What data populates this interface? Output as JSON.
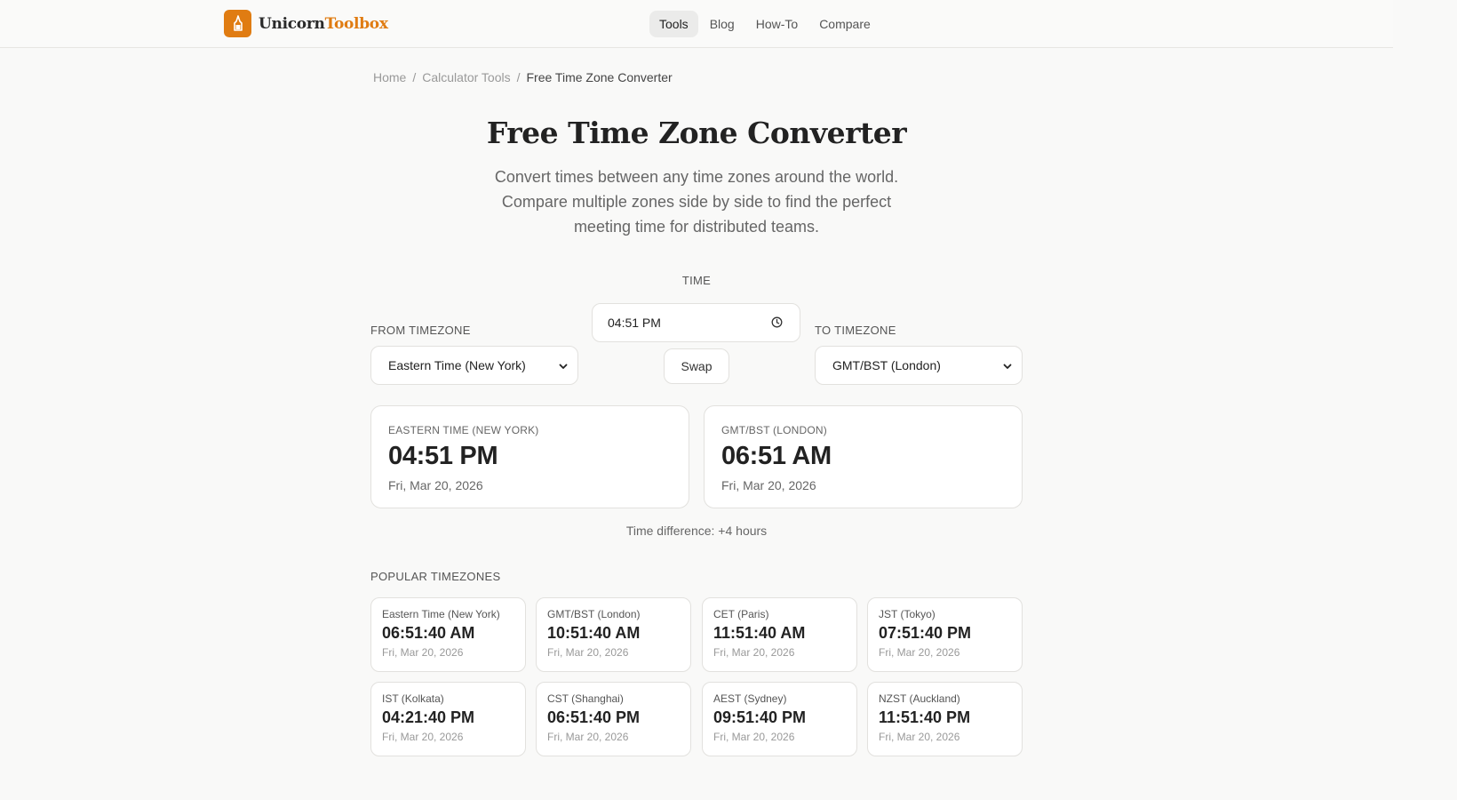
{
  "header": {
    "logo_part1": "Unicorn",
    "logo_part2": "Toolbox",
    "accent": "#e07c12",
    "nav": [
      {
        "label": "Tools",
        "active": true
      },
      {
        "label": "Blog"
      },
      {
        "label": "How-To"
      },
      {
        "label": "Compare"
      }
    ]
  },
  "breadcrumb": {
    "home": "Home",
    "category": "Calculator Tools",
    "current": "Free Time Zone Converter",
    "separator": "/"
  },
  "page": {
    "title": "Free Time Zone Converter",
    "subtitle": "Convert times between any time zones around the world. Compare multiple zones side by side to find the perfect meeting time for distributed teams."
  },
  "converter": {
    "time_label": "TIME",
    "time_value": "04:51 PM",
    "from_label": "FROM TIMEZONE",
    "from_value": "Eastern Time (New York)",
    "to_label": "TO TIMEZONE",
    "to_value": "GMT/BST (London)",
    "swap_label": "Swap"
  },
  "results": {
    "from": {
      "zone": "EASTERN TIME (NEW YORK)",
      "time": "04:51 PM",
      "date": "Fri, Mar 20, 2026"
    },
    "to": {
      "zone": "GMT/BST (LONDON)",
      "time": "06:51 AM",
      "date": "Fri, Mar 20, 2026"
    },
    "difference": "Time difference: +4 hours"
  },
  "popular": {
    "title": "POPULAR TIMEZONES",
    "zones": [
      {
        "zone": "Eastern Time (New York)",
        "time": "06:51:40 AM",
        "date": "Fri, Mar 20, 2026"
      },
      {
        "zone": "GMT/BST (London)",
        "time": "10:51:40 AM",
        "date": "Fri, Mar 20, 2026"
      },
      {
        "zone": "CET (Paris)",
        "time": "11:51:40 AM",
        "date": "Fri, Mar 20, 2026"
      },
      {
        "zone": "JST (Tokyo)",
        "time": "07:51:40 PM",
        "date": "Fri, Mar 20, 2026"
      },
      {
        "zone": "IST (Kolkata)",
        "time": "04:21:40 PM",
        "date": "Fri, Mar 20, 2026"
      },
      {
        "zone": "CST (Shanghai)",
        "time": "06:51:40 PM",
        "date": "Fri, Mar 20, 2026"
      },
      {
        "zone": "AEST (Sydney)",
        "time": "09:51:40 PM",
        "date": "Fri, Mar 20, 2026"
      },
      {
        "zone": "NZST (Auckland)",
        "time": "11:51:40 PM",
        "date": "Fri, Mar 20, 2026"
      }
    ]
  }
}
